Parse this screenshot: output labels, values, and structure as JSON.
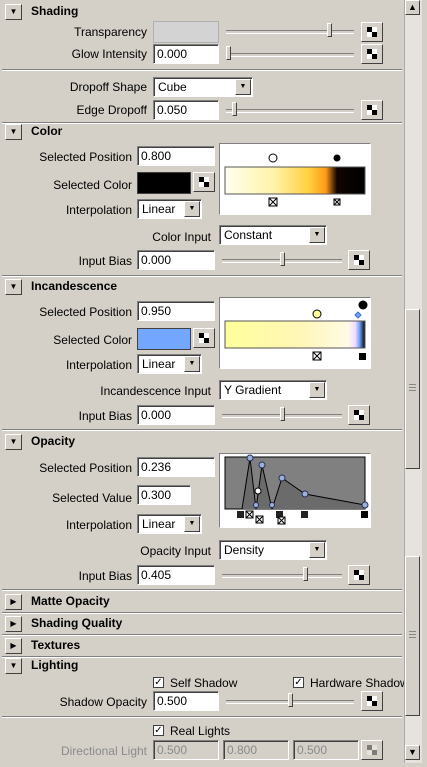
{
  "sections": {
    "shading": {
      "title": "Shading"
    },
    "color": {
      "title": "Color"
    },
    "incandescence": {
      "title": "Incandescence"
    },
    "opacity": {
      "title": "Opacity"
    },
    "matte_opacity": {
      "title": "Matte Opacity"
    },
    "shading_quality": {
      "title": "Shading Quality"
    },
    "textures": {
      "title": "Textures"
    },
    "lighting": {
      "title": "Lighting"
    }
  },
  "shading": {
    "transparency_label": "Transparency",
    "transparency_slider": 0.82,
    "glow_label": "Glow Intensity",
    "glow_value": "0.000",
    "glow_slider": 0.0,
    "dropoff_shape_label": "Dropoff Shape",
    "dropoff_shape_value": "Cube",
    "edge_dropoff_label": "Edge Dropoff",
    "edge_dropoff_value": "0.050",
    "edge_dropoff_slider": 0.05
  },
  "color": {
    "selected_position_label": "Selected Position",
    "selected_position_value": "0.800",
    "selected_color_label": "Selected Color",
    "selected_color": "#000000",
    "interpolation_label": "Interpolation",
    "interpolation_value": "Linear",
    "color_input_label": "Color Input",
    "color_input_value": "Constant",
    "input_bias_label": "Input Bias",
    "input_bias_value": "0.000",
    "input_bias_slider": 0.5
  },
  "incandescence": {
    "selected_position_label": "Selected Position",
    "selected_position_value": "0.950",
    "selected_color_label": "Selected Color",
    "selected_color": "#73a6ff",
    "interpolation_label": "Interpolation",
    "interpolation_value": "Linear",
    "input_label": "Incandescence Input",
    "input_value": "Y Gradient",
    "input_bias_label": "Input Bias",
    "input_bias_value": "0.000",
    "input_bias_slider": 0.5
  },
  "opacity": {
    "selected_position_label": "Selected Position",
    "selected_position_value": "0.236",
    "selected_value_label": "Selected Value",
    "selected_value_value": "0.300",
    "interpolation_label": "Interpolation",
    "interpolation_value": "Linear",
    "input_label": "Opacity Input",
    "input_value": "Density",
    "input_bias_label": "Input Bias",
    "input_bias_value": "0.405",
    "input_bias_slider": 0.7025
  },
  "lighting": {
    "self_shadow_label": "Self Shadow",
    "self_shadow_checked": true,
    "hardware_shadow_label": "Hardware Shadow",
    "hardware_shadow_checked": true,
    "shadow_opacity_label": "Shadow Opacity",
    "shadow_opacity_value": "0.500",
    "shadow_opacity_slider": 0.5,
    "real_lights_label": "Real Lights",
    "real_lights_checked": true,
    "directional_light_label": "Directional Light",
    "directional_light_values": [
      "0.500",
      "0.800",
      "0.500"
    ]
  },
  "colors": {
    "panel_bg": "#d4d0c8",
    "transparency_swatch": "#d3d3d3",
    "opacity_ramp_bg": "#808080"
  }
}
